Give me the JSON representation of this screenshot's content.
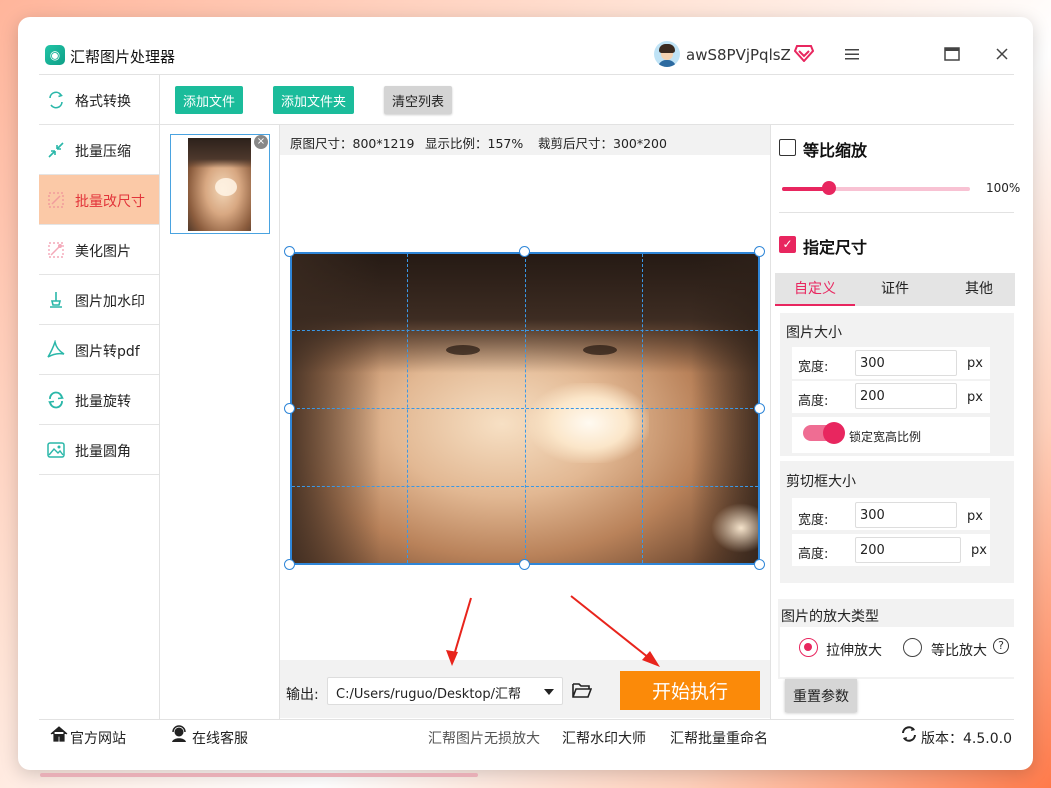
{
  "window": {
    "title": "汇帮图片处理器",
    "username": "awS8PVjPqlsZ"
  },
  "icons": {
    "logo": "app-logo-icon",
    "vip": "vip-diamond-icon",
    "menu": "hamburger-icon",
    "maximize": "maximize-icon",
    "close": "close-icon"
  },
  "sidebar": {
    "items": [
      {
        "label": "格式转换",
        "icon": "format-convert-icon",
        "active": false
      },
      {
        "label": "批量压缩",
        "icon": "compress-icon",
        "active": false
      },
      {
        "label": "批量改尺寸",
        "icon": "resize-icon",
        "active": true
      },
      {
        "label": "美化图片",
        "icon": "beautify-icon",
        "active": false
      },
      {
        "label": "图片加水印",
        "icon": "watermark-icon",
        "active": false
      },
      {
        "label": "图片转pdf",
        "icon": "pdf-icon",
        "active": false
      },
      {
        "label": "批量旋转",
        "icon": "rotate-icon",
        "active": false
      },
      {
        "label": "批量圆角",
        "icon": "rounded-corner-icon",
        "active": false
      }
    ]
  },
  "toolbar": {
    "add_file": "添加文件",
    "add_folder": "添加文件夹",
    "clear_list": "清空列表"
  },
  "preview": {
    "original_size": "原图尺寸：800*1219",
    "display_ratio": "显示比例：157%",
    "cropped_size": "裁剪后尺寸：300*200"
  },
  "output": {
    "label": "输出:",
    "path": "C:/Users/ruguo/Desktop/汇帮",
    "start": "开始执行"
  },
  "right_panel": {
    "proportional_scale": {
      "label": "等比缩放",
      "checked": false,
      "value_text": "100%",
      "value": 0.24
    },
    "specify_size": {
      "label": "指定尺寸",
      "checked": true
    },
    "tabs": [
      {
        "label": "自定义",
        "active": true
      },
      {
        "label": "证件",
        "active": false
      },
      {
        "label": "其他",
        "active": false
      }
    ],
    "image_size": {
      "title": "图片大小",
      "width_label": "宽度:",
      "width_value": "300",
      "height_label": "高度:",
      "height_value": "200",
      "unit": "px",
      "lock_label": "锁定宽高比例"
    },
    "crop_size": {
      "title": "剪切框大小",
      "width_label": "宽度:",
      "width_value": "300",
      "height_label": "高度:",
      "height_value": "200",
      "unit": "px"
    },
    "enlarge_type": {
      "title": "图片的放大类型",
      "options": [
        {
          "label": "拉伸放大",
          "selected": true
        },
        {
          "label": "等比放大",
          "selected": false
        }
      ],
      "help": "?"
    },
    "reset": "重置参数"
  },
  "footer": {
    "official_site": "官方网站",
    "online_service": "在线客服",
    "links": [
      "汇帮图片无损放大",
      "汇帮水印大师",
      "汇帮批量重命名"
    ],
    "version": "版本：4.5.0.0"
  },
  "colors": {
    "accent": "#e8265f",
    "green": "#1bbc9b",
    "orange": "#fb8a09",
    "active_bg": "#fbc9a7",
    "crop_blue": "#2f86d8"
  }
}
